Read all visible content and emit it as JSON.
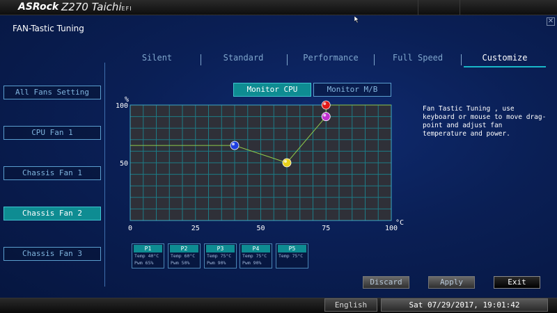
{
  "header": {
    "brand": "ASRock",
    "model": "Z270 Taichi",
    "model_suffix": "EFI"
  },
  "panel": {
    "title": "FAN-Tastic Tuning",
    "close_icon": "close-icon"
  },
  "tabs": [
    {
      "label": "Silent",
      "active": false
    },
    {
      "label": "Standard",
      "active": false
    },
    {
      "label": "Performance",
      "active": false
    },
    {
      "label": "Full Speed",
      "active": false
    },
    {
      "label": "Customize",
      "active": true
    }
  ],
  "sidebar": {
    "items": [
      {
        "label": "All Fans Setting",
        "active": false
      },
      {
        "label": "CPU Fan 1",
        "active": false
      },
      {
        "label": "Chassis Fan 1",
        "active": false
      },
      {
        "label": "Chassis Fan 2",
        "active": true
      },
      {
        "label": "Chassis Fan 3",
        "active": false
      }
    ]
  },
  "monitor": {
    "cpu_label": "Monitor CPU",
    "mb_label": "Monitor M/B",
    "active": "cpu"
  },
  "help_text": "Fan Tastic Tuning , use keyboard or mouse to move drag-point and adjust fan temperature and power.",
  "chart_data": {
    "type": "line",
    "ylabel": "%",
    "xlabel": "°C",
    "xlim": [
      0,
      100
    ],
    "ylim": [
      0,
      100
    ],
    "x_ticks": [
      "0",
      "25",
      "50",
      "75",
      "100"
    ],
    "y_ticks": [
      "50",
      "100"
    ],
    "grid": true,
    "points": [
      {
        "name": "P1",
        "x": 40,
        "y": 65,
        "color": "#1f3fe0"
      },
      {
        "name": "P2",
        "x": 60,
        "y": 50,
        "color": "#e8d21a"
      },
      {
        "name": "P3",
        "x": 75,
        "y": 90,
        "color": "#c030d0"
      },
      {
        "name": "P4",
        "x": 75,
        "y": 90,
        "color": "#c030d0"
      },
      {
        "name": "P5",
        "x": 75,
        "y": 100,
        "color": "#e01818"
      }
    ],
    "line_color": "#8fc94a"
  },
  "point_boxes": [
    {
      "name": "P1",
      "temp": "Temp 40°C",
      "pwm": "Pwm  65%"
    },
    {
      "name": "P2",
      "temp": "Temp 60°C",
      "pwm": "Pwm  50%"
    },
    {
      "name": "P3",
      "temp": "Temp 75°C",
      "pwm": "Pwm  90%"
    },
    {
      "name": "P4",
      "temp": "Temp 75°C",
      "pwm": "Pwm  90%"
    },
    {
      "name": "P5",
      "temp": "Temp 75°C",
      "pwm": ""
    }
  ],
  "actions": {
    "discard": "Discard",
    "apply": "Apply",
    "exit": "Exit"
  },
  "footer": {
    "language": "English",
    "datetime": "Sat 07/29/2017, 19:01:42"
  },
  "colors": {
    "accent": "#0e8c92",
    "tab_underline": "#19b8c9"
  }
}
